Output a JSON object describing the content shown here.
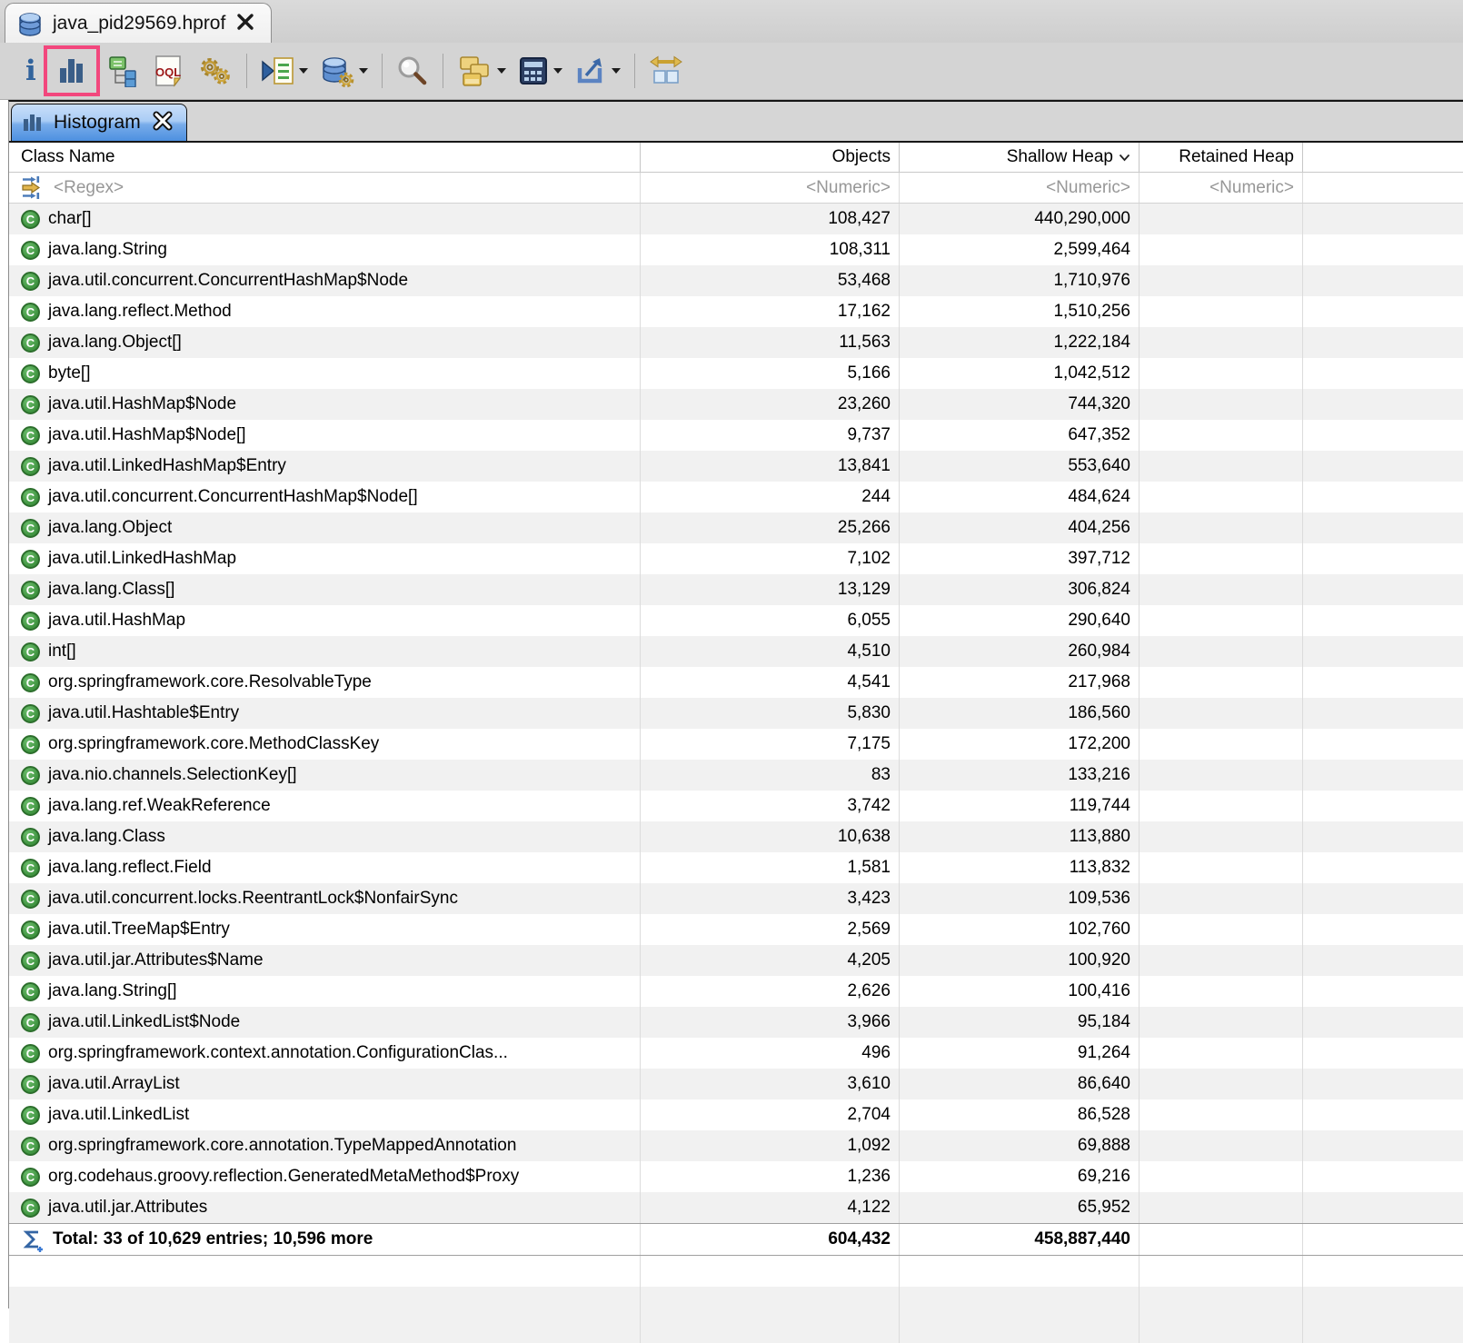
{
  "editor_tab": {
    "title": "java_pid29569.hprof"
  },
  "view_tab": {
    "label": "Histogram"
  },
  "toolbar": {
    "oql_label": "OQL",
    "icons": [
      "info-icon",
      "histogram-icon",
      "dominator-tree-icon",
      "oql-icon",
      "gears-icon",
      "query-browser-icon",
      "heap-objects-icon",
      "search-icon",
      "grouping-icon",
      "calculator-icon",
      "export-icon",
      "fit-columns-icon"
    ],
    "highlight_color": "#f2477d"
  },
  "table": {
    "columns": [
      "Class Name",
      "Objects",
      "Shallow Heap",
      "Retained Heap"
    ],
    "sorted_by": "Shallow Heap",
    "filter": {
      "regex": "<Regex>",
      "numeric": "<Numeric>"
    },
    "rows": [
      {
        "name": "char[]",
        "objects": "108,427",
        "shallow": "440,290,000",
        "retained": ""
      },
      {
        "name": "java.lang.String",
        "objects": "108,311",
        "shallow": "2,599,464",
        "retained": ""
      },
      {
        "name": "java.util.concurrent.ConcurrentHashMap$Node",
        "objects": "53,468",
        "shallow": "1,710,976",
        "retained": ""
      },
      {
        "name": "java.lang.reflect.Method",
        "objects": "17,162",
        "shallow": "1,510,256",
        "retained": ""
      },
      {
        "name": "java.lang.Object[]",
        "objects": "11,563",
        "shallow": "1,222,184",
        "retained": ""
      },
      {
        "name": "byte[]",
        "objects": "5,166",
        "shallow": "1,042,512",
        "retained": ""
      },
      {
        "name": "java.util.HashMap$Node",
        "objects": "23,260",
        "shallow": "744,320",
        "retained": ""
      },
      {
        "name": "java.util.HashMap$Node[]",
        "objects": "9,737",
        "shallow": "647,352",
        "retained": ""
      },
      {
        "name": "java.util.LinkedHashMap$Entry",
        "objects": "13,841",
        "shallow": "553,640",
        "retained": ""
      },
      {
        "name": "java.util.concurrent.ConcurrentHashMap$Node[]",
        "objects": "244",
        "shallow": "484,624",
        "retained": ""
      },
      {
        "name": "java.lang.Object",
        "objects": "25,266",
        "shallow": "404,256",
        "retained": ""
      },
      {
        "name": "java.util.LinkedHashMap",
        "objects": "7,102",
        "shallow": "397,712",
        "retained": ""
      },
      {
        "name": "java.lang.Class[]",
        "objects": "13,129",
        "shallow": "306,824",
        "retained": ""
      },
      {
        "name": "java.util.HashMap",
        "objects": "6,055",
        "shallow": "290,640",
        "retained": ""
      },
      {
        "name": "int[]",
        "objects": "4,510",
        "shallow": "260,984",
        "retained": ""
      },
      {
        "name": "org.springframework.core.ResolvableType",
        "objects": "4,541",
        "shallow": "217,968",
        "retained": ""
      },
      {
        "name": "java.util.Hashtable$Entry",
        "objects": "5,830",
        "shallow": "186,560",
        "retained": ""
      },
      {
        "name": "org.springframework.core.MethodClassKey",
        "objects": "7,175",
        "shallow": "172,200",
        "retained": ""
      },
      {
        "name": "java.nio.channels.SelectionKey[]",
        "objects": "83",
        "shallow": "133,216",
        "retained": ""
      },
      {
        "name": "java.lang.ref.WeakReference",
        "objects": "3,742",
        "shallow": "119,744",
        "retained": ""
      },
      {
        "name": "java.lang.Class",
        "objects": "10,638",
        "shallow": "113,880",
        "retained": ""
      },
      {
        "name": "java.lang.reflect.Field",
        "objects": "1,581",
        "shallow": "113,832",
        "retained": ""
      },
      {
        "name": "java.util.concurrent.locks.ReentrantLock$NonfairSync",
        "objects": "3,423",
        "shallow": "109,536",
        "retained": ""
      },
      {
        "name": "java.util.TreeMap$Entry",
        "objects": "2,569",
        "shallow": "102,760",
        "retained": ""
      },
      {
        "name": "java.util.jar.Attributes$Name",
        "objects": "4,205",
        "shallow": "100,920",
        "retained": ""
      },
      {
        "name": "java.lang.String[]",
        "objects": "2,626",
        "shallow": "100,416",
        "retained": ""
      },
      {
        "name": "java.util.LinkedList$Node",
        "objects": "3,966",
        "shallow": "95,184",
        "retained": ""
      },
      {
        "name": "org.springframework.context.annotation.ConfigurationClas...",
        "objects": "496",
        "shallow": "91,264",
        "retained": ""
      },
      {
        "name": "java.util.ArrayList",
        "objects": "3,610",
        "shallow": "86,640",
        "retained": ""
      },
      {
        "name": "java.util.LinkedList",
        "objects": "2,704",
        "shallow": "86,528",
        "retained": ""
      },
      {
        "name": "org.springframework.core.annotation.TypeMappedAnnotation",
        "objects": "1,092",
        "shallow": "69,888",
        "retained": ""
      },
      {
        "name": "org.codehaus.groovy.reflection.GeneratedMetaMethod$Proxy",
        "objects": "1,236",
        "shallow": "69,216",
        "retained": ""
      },
      {
        "name": "java.util.jar.Attributes",
        "objects": "4,122",
        "shallow": "65,952",
        "retained": ""
      }
    ],
    "total": {
      "label": "Total: 33 of 10,629 entries; 10,596 more",
      "objects": "604,432",
      "shallow": "458,887,440",
      "retained": ""
    }
  }
}
